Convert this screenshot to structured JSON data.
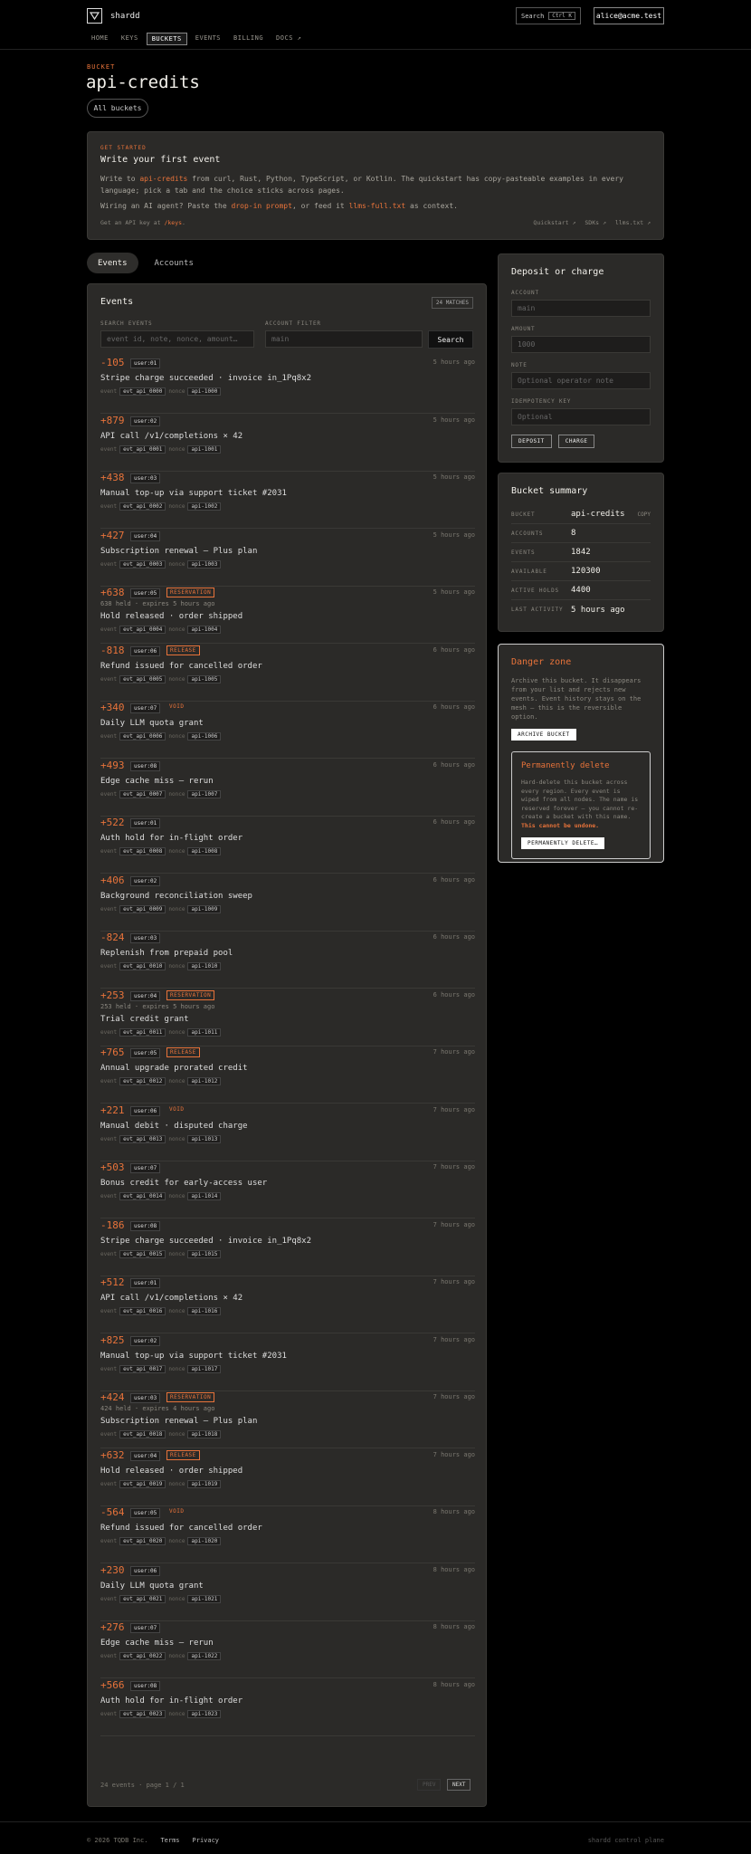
{
  "header": {
    "brand": "shardd",
    "search_label": "Search",
    "search_kbd": "Ctrl K",
    "user_email": "alice@acme.test",
    "nav": [
      "HOME",
      "KEYS",
      "BUCKETS",
      "EVENTS",
      "BILLING",
      "DOCS ↗"
    ],
    "nav_active": "BUCKETS"
  },
  "hero": {
    "eyebrow": "BUCKET",
    "title": "api-credits",
    "back_button": "All buckets"
  },
  "get_started": {
    "eyebrow": "GET STARTED",
    "title": "Write your first event",
    "line1_pre": "Write to ",
    "line1_bucket": "api-credits",
    "line1_post": " from curl, Rust, Python, TypeScript, or Kotlin. The quickstart has copy-pasteable examples in every language; pick a tab and the choice sticks across pages.",
    "line2_pre": "Wiring an AI agent? Paste the ",
    "line2_link1": "drop-in prompt",
    "line2_mid": ", or feed it ",
    "line2_link2": "llms-full.txt",
    "line2_post": " as context.",
    "foot_pre": "Get an API key at ",
    "foot_link": "/keys",
    "foot_post": ".",
    "links": [
      "Quickstart ↗",
      "SDKs ↗",
      "llms.txt ↗"
    ]
  },
  "tabs": [
    "Events",
    "Accounts"
  ],
  "events_panel": {
    "title": "Events",
    "matches": "24 MATCHES",
    "search_label": "SEARCH EVENTS",
    "search_placeholder": "event id, note, nonce, amount…",
    "filter_label": "ACCOUNT FILTER",
    "filter_placeholder": "main",
    "search_button": "Search",
    "event_key": "event",
    "nonce_key": "nonce",
    "footer": "24 events · page 1 / 1",
    "prev": "PREV",
    "next": "NEXT"
  },
  "events": [
    {
      "amount": "-105",
      "user": "user:01",
      "badge": "",
      "time": "5 hours ago",
      "sub": "",
      "desc": "Stripe charge succeeded · invoice in_1Pq8x2",
      "event_id": "evt_api_0000",
      "nonce": "api-1000"
    },
    {
      "amount": "+879",
      "user": "user:02",
      "badge": "",
      "time": "5 hours ago",
      "sub": "",
      "desc": "API call /v1/completions × 42",
      "event_id": "evt_api_0001",
      "nonce": "api-1001"
    },
    {
      "amount": "+438",
      "user": "user:03",
      "badge": "",
      "time": "5 hours ago",
      "sub": "",
      "desc": "Manual top-up via support ticket #2031",
      "event_id": "evt_api_0002",
      "nonce": "api-1002"
    },
    {
      "amount": "+427",
      "user": "user:04",
      "badge": "",
      "time": "5 hours ago",
      "sub": "",
      "desc": "Subscription renewal — Plus plan",
      "event_id": "evt_api_0003",
      "nonce": "api-1003"
    },
    {
      "amount": "+638",
      "user": "user:05",
      "badge": "RESERVATION",
      "time": "5 hours ago",
      "sub": "638 held · expires 5 hours ago",
      "desc": "Hold released · order shipped",
      "event_id": "evt_api_0004",
      "nonce": "api-1004"
    },
    {
      "amount": "-818",
      "user": "user:06",
      "badge": "RELEASE",
      "time": "6 hours ago",
      "sub": "",
      "desc": "Refund issued for cancelled order",
      "event_id": "evt_api_0005",
      "nonce": "api-1005"
    },
    {
      "amount": "+340",
      "user": "user:07",
      "badge": "VOID",
      "time": "6 hours ago",
      "sub": "",
      "desc": "Daily LLM quota grant",
      "event_id": "evt_api_0006",
      "nonce": "api-1006"
    },
    {
      "amount": "+493",
      "user": "user:08",
      "badge": "",
      "time": "6 hours ago",
      "sub": "",
      "desc": "Edge cache miss — rerun",
      "event_id": "evt_api_0007",
      "nonce": "api-1007"
    },
    {
      "amount": "+522",
      "user": "user:01",
      "badge": "",
      "time": "6 hours ago",
      "sub": "",
      "desc": "Auth hold for in-flight order",
      "event_id": "evt_api_0008",
      "nonce": "api-1008"
    },
    {
      "amount": "+406",
      "user": "user:02",
      "badge": "",
      "time": "6 hours ago",
      "sub": "",
      "desc": "Background reconciliation sweep",
      "event_id": "evt_api_0009",
      "nonce": "api-1009"
    },
    {
      "amount": "-824",
      "user": "user:03",
      "badge": "",
      "time": "6 hours ago",
      "sub": "",
      "desc": "Replenish from prepaid pool",
      "event_id": "evt_api_0010",
      "nonce": "api-1010"
    },
    {
      "amount": "+253",
      "user": "user:04",
      "badge": "RESERVATION",
      "time": "6 hours ago",
      "sub": "253 held · expires 5 hours ago",
      "desc": "Trial credit grant",
      "event_id": "evt_api_0011",
      "nonce": "api-1011"
    },
    {
      "amount": "+765",
      "user": "user:05",
      "badge": "RELEASE",
      "time": "7 hours ago",
      "sub": "",
      "desc": "Annual upgrade prorated credit",
      "event_id": "evt_api_0012",
      "nonce": "api-1012"
    },
    {
      "amount": "+221",
      "user": "user:06",
      "badge": "VOID",
      "time": "7 hours ago",
      "sub": "",
      "desc": "Manual debit · disputed charge",
      "event_id": "evt_api_0013",
      "nonce": "api-1013"
    },
    {
      "amount": "+503",
      "user": "user:07",
      "badge": "",
      "time": "7 hours ago",
      "sub": "",
      "desc": "Bonus credit for early-access user",
      "event_id": "evt_api_0014",
      "nonce": "api-1014"
    },
    {
      "amount": "-186",
      "user": "user:08",
      "badge": "",
      "time": "7 hours ago",
      "sub": "",
      "desc": "Stripe charge succeeded · invoice in_1Pq8x2",
      "event_id": "evt_api_0015",
      "nonce": "api-1015"
    },
    {
      "amount": "+512",
      "user": "user:01",
      "badge": "",
      "time": "7 hours ago",
      "sub": "",
      "desc": "API call /v1/completions × 42",
      "event_id": "evt_api_0016",
      "nonce": "api-1016"
    },
    {
      "amount": "+825",
      "user": "user:02",
      "badge": "",
      "time": "7 hours ago",
      "sub": "",
      "desc": "Manual top-up via support ticket #2031",
      "event_id": "evt_api_0017",
      "nonce": "api-1017"
    },
    {
      "amount": "+424",
      "user": "user:03",
      "badge": "RESERVATION",
      "time": "7 hours ago",
      "sub": "424 held · expires 4 hours ago",
      "desc": "Subscription renewal — Plus plan",
      "event_id": "evt_api_0018",
      "nonce": "api-1018"
    },
    {
      "amount": "+632",
      "user": "user:04",
      "badge": "RELEASE",
      "time": "7 hours ago",
      "sub": "",
      "desc": "Hold released · order shipped",
      "event_id": "evt_api_0019",
      "nonce": "api-1019"
    },
    {
      "amount": "-564",
      "user": "user:05",
      "badge": "VOID",
      "time": "8 hours ago",
      "sub": "",
      "desc": "Refund issued for cancelled order",
      "event_id": "evt_api_0020",
      "nonce": "api-1020"
    },
    {
      "amount": "+230",
      "user": "user:06",
      "badge": "",
      "time": "8 hours ago",
      "sub": "",
      "desc": "Daily LLM quota grant",
      "event_id": "evt_api_0021",
      "nonce": "api-1021"
    },
    {
      "amount": "+276",
      "user": "user:07",
      "badge": "",
      "time": "8 hours ago",
      "sub": "",
      "desc": "Edge cache miss — rerun",
      "event_id": "evt_api_0022",
      "nonce": "api-1022"
    },
    {
      "amount": "+566",
      "user": "user:08",
      "badge": "",
      "time": "8 hours ago",
      "sub": "",
      "desc": "Auth hold for in-flight order",
      "event_id": "evt_api_0023",
      "nonce": "api-1023"
    }
  ],
  "deposit": {
    "title": "Deposit or charge",
    "account_label": "ACCOUNT",
    "account_placeholder": "main",
    "amount_label": "AMOUNT",
    "amount_placeholder": "1000",
    "note_label": "NOTE",
    "note_placeholder": "Optional operator note",
    "idem_label": "IDEMPOTENCY KEY",
    "idem_placeholder": "Optional",
    "deposit_button": "DEPOSIT",
    "charge_button": "CHARGE"
  },
  "summary": {
    "title": "Bucket summary",
    "copy": "COPY",
    "rows": [
      {
        "k": "BUCKET",
        "v": "api-credits"
      },
      {
        "k": "ACCOUNTS",
        "v": "8"
      },
      {
        "k": "EVENTS",
        "v": "1842"
      },
      {
        "k": "AVAILABLE",
        "v": "120300"
      },
      {
        "k": "ACTIVE HOLDS",
        "v": "4400"
      },
      {
        "k": "LAST ACTIVITY",
        "v": "5 hours ago"
      }
    ]
  },
  "danger": {
    "title": "Danger zone",
    "text": "Archive this bucket. It disappears from your list and rejects new events. Event history stays on the mesh — this is the reversible option.",
    "archive_button": "ARCHIVE BUCKET",
    "perm_title": "Permanently delete",
    "perm_text": "Hard-delete this bucket across every region. Every event is wiped from all nodes. The name is reserved forever — you cannot re-create a bucket with this name. ",
    "perm_warn": "This cannot be undone.",
    "perm_button": "PERMANENTLY DELETE…"
  },
  "footer": {
    "copyright": "© 2026 TQDB Inc.",
    "terms": "Terms",
    "privacy": "Privacy",
    "right": "shardd control plane"
  },
  "colors": {
    "accent": "#e8733a",
    "card": "#2b2a28",
    "background": "#000000"
  }
}
